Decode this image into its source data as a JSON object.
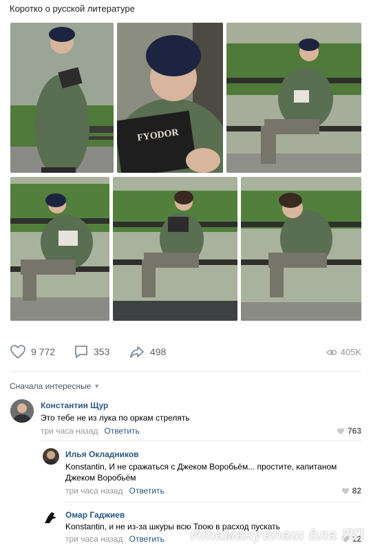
{
  "post": {
    "title": "Коротко о русской литературе"
  },
  "photos": [
    {
      "name": "photo-1",
      "scene": "standing"
    },
    {
      "name": "photo-2",
      "scene": "closeup"
    },
    {
      "name": "photo-3",
      "scene": "bench-laugh"
    },
    {
      "name": "photo-4",
      "scene": "bench-slouch"
    },
    {
      "name": "photo-5",
      "scene": "bench-read"
    },
    {
      "name": "photo-6",
      "scene": "bench-despair"
    }
  ],
  "book_cover": {
    "author": "FYODOR"
  },
  "actions": {
    "likes": "9 772",
    "comments": "353",
    "shares": "498",
    "views": "405K"
  },
  "comments_header": {
    "sort_label": "Сначала интересные"
  },
  "comments": [
    {
      "author": "Константин Щур",
      "text": "Это тебе не из лука по оркам стрелять",
      "time": "три часа назад",
      "reply": "Ответить",
      "likes": "763"
    },
    {
      "author": "Илья Окладников",
      "text": "Konstantin, И не сражаться с Джеком Воробьём... простите, капитаном Джеком Воробьём",
      "time": "три часа назад",
      "reply": "Ответить",
      "likes": "82"
    },
    {
      "author": "Омар Гаджиев",
      "text": "Konstantin, и не из-за шкуры всю Трою в расход пускать",
      "time": "три часа назад",
      "reply": "Ответить",
      "likes": "12"
    }
  ],
  "watermark": "Иmaмaнyвnaш ɓлa ЯП",
  "colors": {
    "link": "#2a5885",
    "meta": "#939699",
    "jacket": "#5a6e52",
    "hat": "#1d2440"
  }
}
